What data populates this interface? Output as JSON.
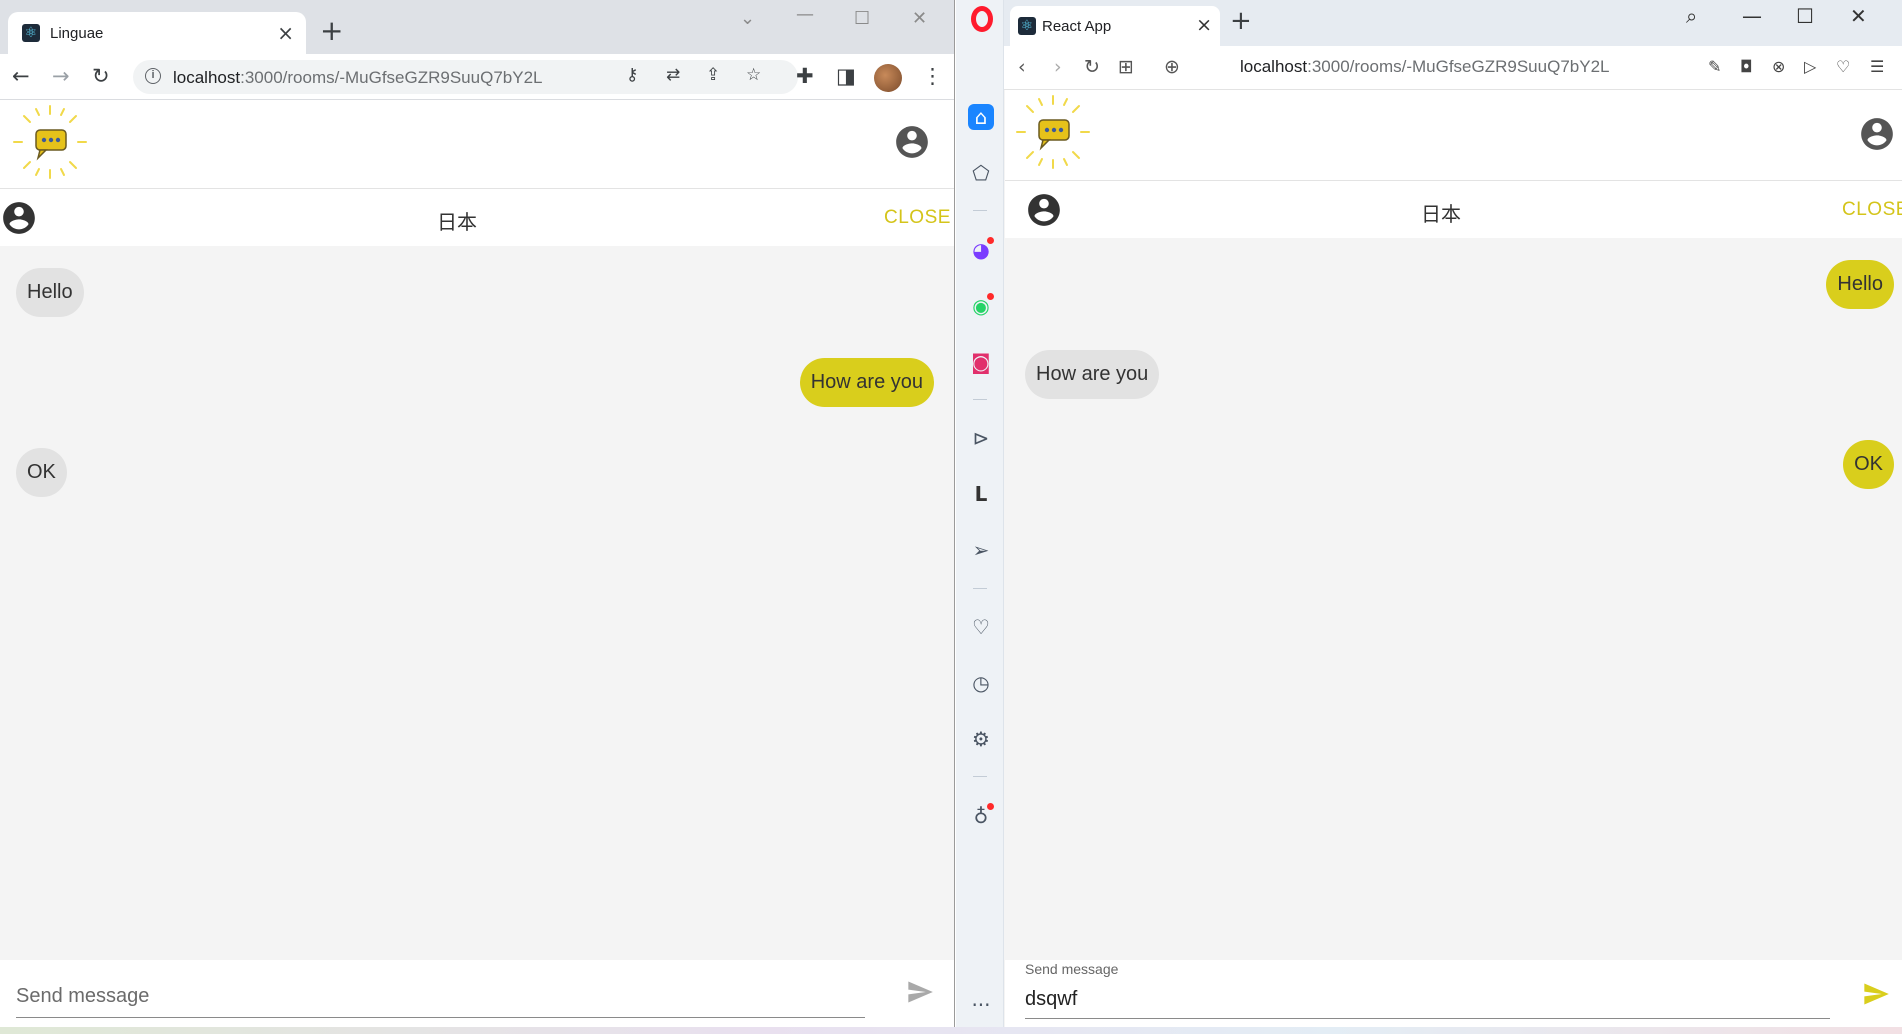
{
  "left_browser": {
    "tab_title": "Linguae",
    "new_tab_icon": "plus-icon",
    "url_host": "localhost",
    "url_path": ":3000/rooms/-MuGfseGZR9SuuQ7bY2L",
    "toolbar_icons": [
      "back-icon",
      "forward-icon",
      "reload-icon",
      "key-icon",
      "translate-icon",
      "share-icon",
      "star-icon",
      "extensions-icon",
      "sidepanel-icon",
      "kebab-menu-icon"
    ]
  },
  "right_browser": {
    "tab_title": "React App",
    "url_host": "localhost",
    "url_path": ":3000/rooms/-MuGfseGZR9SuuQ7bY2L",
    "sidebar_icons": [
      "home-icon",
      "pinboard-icon",
      "messenger-icon",
      "whatsapp-icon",
      "instagram-icon",
      "player-icon",
      "l-icon",
      "send-icon",
      "heart-icon",
      "history-icon",
      "settings-icon",
      "tips-icon",
      "more-icon"
    ]
  },
  "left_app": {
    "chat_title": "日本",
    "close_label": "CLOSE",
    "messages": [
      {
        "text": "Hello",
        "side": "left"
      },
      {
        "text": "How are you",
        "side": "right"
      },
      {
        "text": "OK",
        "side": "left"
      }
    ],
    "composer_placeholder": "Send message",
    "composer_value": ""
  },
  "right_app": {
    "chat_title": "日本",
    "close_label": "CLOSE",
    "messages": [
      {
        "text": "Hello",
        "side": "right"
      },
      {
        "text": "How are you",
        "side": "left"
      },
      {
        "text": "OK",
        "side": "right"
      }
    ],
    "composer_label": "Send message",
    "composer_value": "dsqwf"
  },
  "colors": {
    "accent_yellow": "#d9ce1c",
    "close_text": "#d4c41a",
    "bubble_gray": "#e2e2e2",
    "background": "#f4f4f4"
  }
}
